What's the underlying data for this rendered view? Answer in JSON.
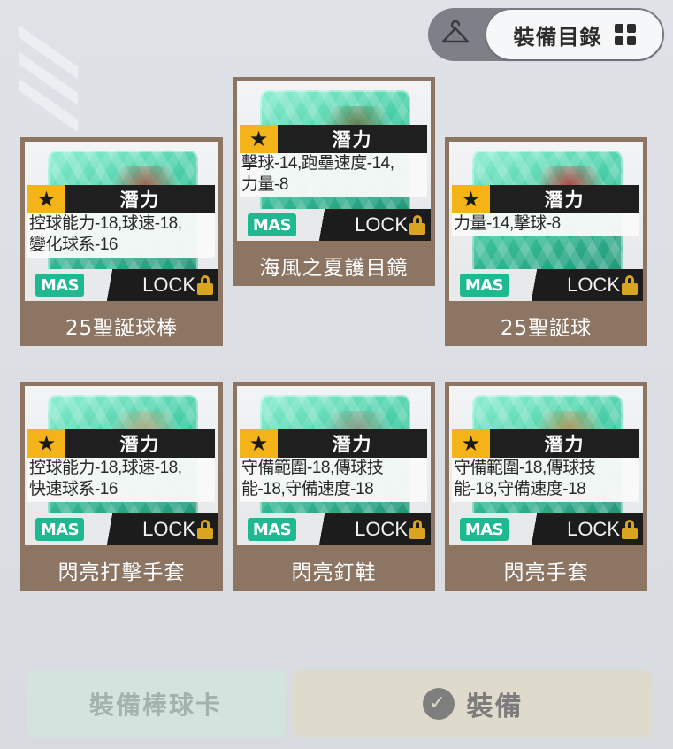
{
  "header": {
    "hanger_icon": "hanger-icon",
    "catalog_label": "裝備目錄",
    "grid_icon": "grid-icon"
  },
  "cards": [
    {
      "potential_label": "潛力",
      "stats": [
        "控球能力-18,球速-18,",
        "變化球系-16"
      ],
      "mas": "MAS",
      "lock": "LOCK",
      "name": "25聖誕球棒",
      "art_color": "#b44b3a"
    },
    {
      "potential_label": "潛力",
      "stats": [
        "擊球-14,跑壘速度-14,",
        "力量-8"
      ],
      "mas": "MAS",
      "lock": "LOCK",
      "name": "海風之夏護目鏡",
      "art_color": "#6b6a3a"
    },
    {
      "potential_label": "潛力",
      "stats": [
        "力量-14,擊球-8"
      ],
      "mas": "MAS",
      "lock": "LOCK",
      "name": "25聖誕球",
      "art_color": "#c92a2a"
    },
    {
      "potential_label": "潛力",
      "stats": [
        "控球能力-18,球速-18,",
        "快速球系-16"
      ],
      "mas": "MAS",
      "lock": "LOCK",
      "name": "閃亮打擊手套",
      "art_color": "#c9a27a"
    },
    {
      "potential_label": "潛力",
      "stats": [
        "守備範圍-18,傳球技",
        "能-18,守備速度-18"
      ],
      "mas": "MAS",
      "lock": "LOCK",
      "name": "閃亮釘鞋",
      "art_color": "#9a8d7d"
    },
    {
      "potential_label": "潛力",
      "stats": [
        "守備範圍-18,傳球技",
        "能-18,守備速度-18"
      ],
      "mas": "MAS",
      "lock": "LOCK",
      "name": "閃亮手套",
      "art_color": "#c38a4a"
    }
  ],
  "footer": {
    "equip_card_label": "裝備棒球卡",
    "equip_label": "裝備",
    "check_icon": "check-circle-icon"
  },
  "colors": {
    "card_frame": "#8c7563",
    "mas_badge": "#1eb990",
    "star_badge": "#f4b316",
    "lock_icon": "#d9a520"
  }
}
